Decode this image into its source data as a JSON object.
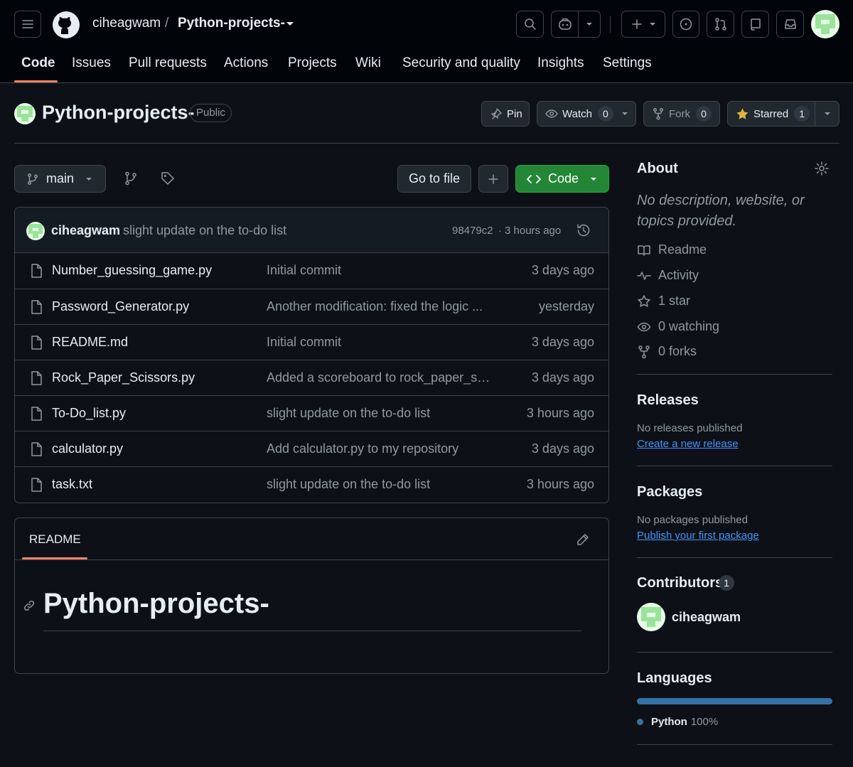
{
  "header": {
    "owner": "ciheagwam",
    "separator": "/",
    "repo": "Python-projects-"
  },
  "tabs": [
    {
      "label": "Code",
      "selected": true
    },
    {
      "label": "Issues"
    },
    {
      "label": "Pull requests"
    },
    {
      "label": "Actions"
    },
    {
      "label": "Projects"
    },
    {
      "label": "Wiki"
    },
    {
      "label": "Security and quality"
    },
    {
      "label": "Insights"
    },
    {
      "label": "Settings"
    }
  ],
  "repo": {
    "title": "Python-projects-",
    "visibility": "Public",
    "pin_label": "Pin",
    "watch_label": "Watch",
    "watch_count": "0",
    "fork_label": "Fork",
    "fork_count": "0",
    "starred_label": "Starred",
    "star_count": "1"
  },
  "toolbar": {
    "branch": "main",
    "go_to_file": "Go to file",
    "code_label": "Code"
  },
  "latest_commit": {
    "author": "ciheagwam",
    "message": "slight update on the to-do list",
    "hash": "98479c2",
    "dot": "·",
    "time": "3 hours ago"
  },
  "files": [
    {
      "name": "Number_guessing_game.py",
      "message": "Initial commit",
      "date": "3 days ago"
    },
    {
      "name": "Password_Generator.py",
      "message": "Another modification: fixed the logic ...",
      "date": "yesterday"
    },
    {
      "name": "README.md",
      "message": "Initial commit",
      "date": "3 days ago"
    },
    {
      "name": "Rock_Paper_Scissors.py",
      "message": "Added a scoreboard to rock_paper_sc...",
      "date": "3 days ago"
    },
    {
      "name": "To-Do_list.py",
      "message": "slight update on the to-do list",
      "date": "3 hours ago"
    },
    {
      "name": "calculator.py",
      "message": "Add calculator.py to my repository",
      "date": "3 days ago"
    },
    {
      "name": "task.txt",
      "message": "slight update on the to-do list",
      "date": "3 hours ago"
    }
  ],
  "readme": {
    "tab_label": "README",
    "heading": "Python-projects-"
  },
  "about": {
    "title": "About",
    "description": "No description, website, or topics provided.",
    "readme": "Readme",
    "activity": "Activity",
    "stars": "1 star",
    "watching": "0 watching",
    "forks": "0 forks"
  },
  "releases": {
    "title": "Releases",
    "empty": "No releases published",
    "link": "Create a new release"
  },
  "packages": {
    "title": "Packages",
    "empty": "No packages published",
    "link": "Publish your first package"
  },
  "contributors": {
    "title": "Contributors",
    "count": "1",
    "name": "ciheagwam"
  },
  "languages": {
    "title": "Languages",
    "name": "Python",
    "percent": "100%",
    "share": 1.0,
    "color": "#3572A5"
  },
  "colors": {
    "accent_underline": "#f78166",
    "code_button": "#238636",
    "link": "#4493f8",
    "star": "#e3b341"
  }
}
